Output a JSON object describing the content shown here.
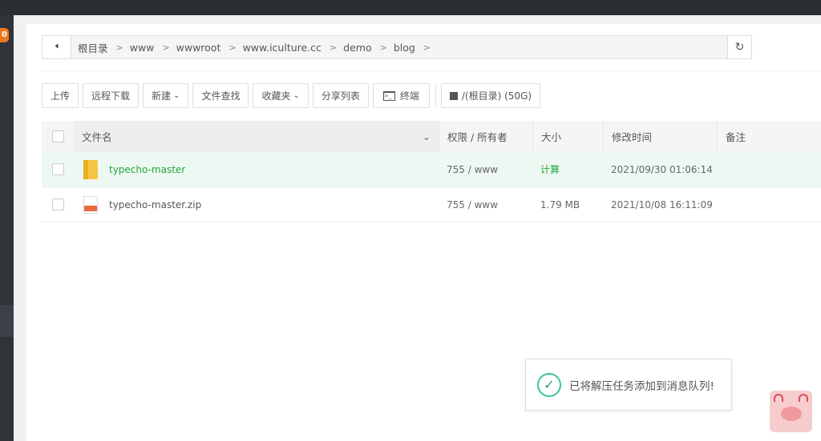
{
  "sidebar": {
    "badge": "0"
  },
  "breadcrumb": {
    "items": [
      "根目录",
      "www",
      "wwwroot",
      "www.iculture.cc",
      "demo",
      "blog"
    ],
    "separator": ">"
  },
  "toolbar": {
    "upload": "上传",
    "remote_download": "远程下载",
    "new": "新建",
    "file_search": "文件查找",
    "favorites": "收藏夹",
    "share_list": "分享列表",
    "terminal": "终端",
    "disk": "/(根目录) (50G)"
  },
  "table": {
    "headers": {
      "name": "文件名",
      "perm": "权限 / 所有者",
      "size": "大小",
      "mtime": "修改时间",
      "note": "备注"
    },
    "rows": [
      {
        "name": "typecho-master",
        "perm": "755 / www",
        "size": "计算",
        "mtime": "2021/09/30 01:06:14",
        "note": "",
        "type": "folder"
      },
      {
        "name": "typecho-master.zip",
        "perm": "755 / www",
        "size": "1.79 MB",
        "mtime": "2021/10/08 16:11:09",
        "note": "",
        "type": "zip"
      }
    ]
  },
  "toast": {
    "message": "已将解压任务添加到消息队列!"
  },
  "colors": {
    "accent": "#20a53a",
    "badge": "#f0791f",
    "highlight_row": "#eef8f2"
  }
}
